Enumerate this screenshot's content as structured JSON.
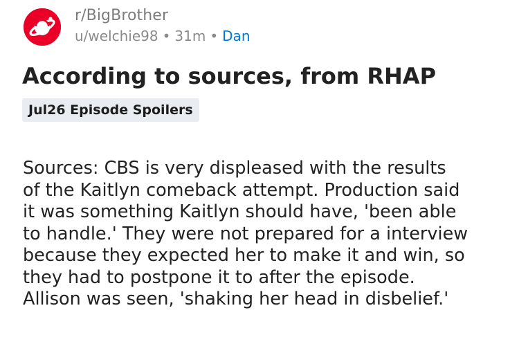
{
  "post": {
    "subreddit": "r/BigBrother",
    "author": "u/welchie98",
    "separator": "•",
    "age": "31m",
    "author_flair": "Dan",
    "title": "According to sources, from RHAP",
    "link_flair": "Jul26 Episode Spoilers",
    "body_lines": [
      "Sources: CBS is very displeased with the results",
      "of the Kaitlyn comeback attempt. Production said",
      "it was something Kaitlyn should have, 'been able",
      "to handle.' They were not prepared for a interview",
      "because they expected her to make it and win, so",
      "they had to postpone it to after the episode.",
      "Allison was seen, 'shaking her head in disbelief.'"
    ]
  },
  "colors": {
    "subreddit_icon_bg": "#ea0027",
    "flair_user": "#0079d3",
    "link_flair_bg": "#e9ecf0"
  },
  "icons": {
    "subreddit_icon": "planet-icon"
  }
}
